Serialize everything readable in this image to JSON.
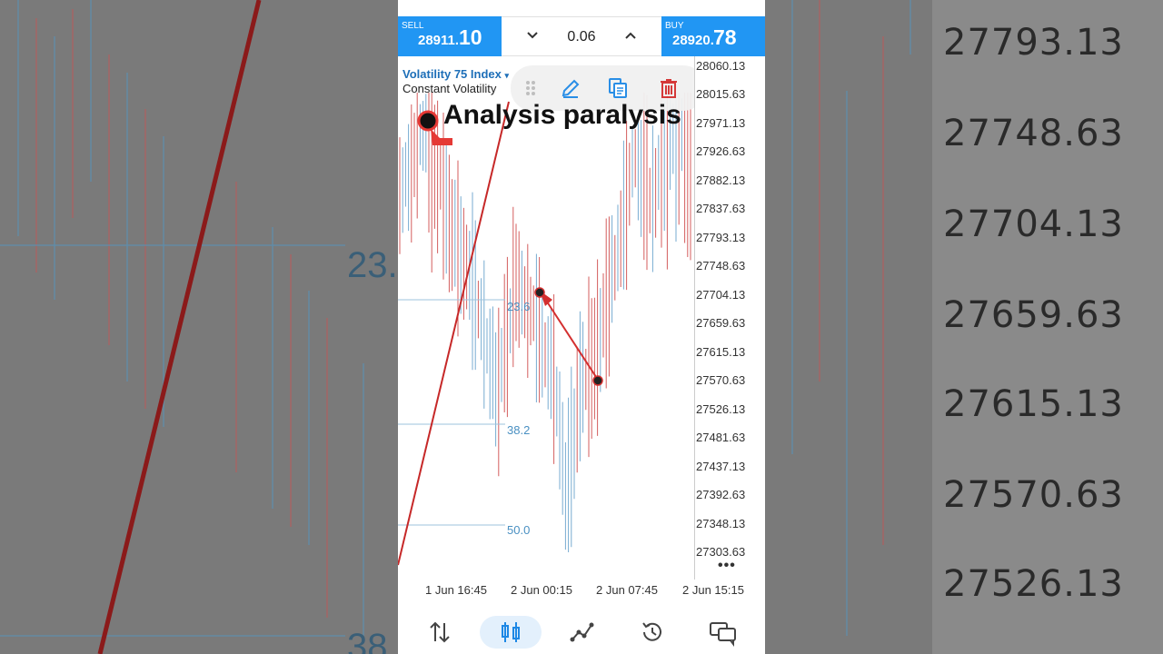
{
  "trade": {
    "sell_label": "SELL",
    "sell_price_main": "28911.",
    "sell_price_big": "10",
    "buy_label": "BUY",
    "buy_price_main": "28920.",
    "buy_price_big": "78",
    "volume": "0.06"
  },
  "chart": {
    "symbol": "Volatility 75 Index",
    "symbol_caret": "▾",
    "subtitle": "Constant Volatility",
    "overlay_text": "Analysis paralysis",
    "fib_levels": [
      "23.6",
      "38.2",
      "50.0"
    ],
    "price_labels": [
      "28060.13",
      "28015.63",
      "27971.13",
      "27926.63",
      "27882.13",
      "27837.63",
      "27793.13",
      "27748.63",
      "27704.13",
      "27659.63",
      "27615.13",
      "27570.63",
      "27526.13",
      "27481.63",
      "27437.13",
      "27392.63",
      "27348.13",
      "27303.63"
    ],
    "time_labels": [
      "1 Jun 16:45",
      "2 Jun 00:15",
      "2 Jun 07:45",
      "2 Jun 15:15"
    ],
    "more_label": "•••"
  },
  "toolbar": {
    "icons": [
      "drag-handle-icon",
      "edit-pencil-icon",
      "copy-icon",
      "trash-icon"
    ]
  },
  "bottom_nav": {
    "icons": [
      "trade-arrows-icon",
      "candles-icon",
      "indicators-icon",
      "history-icon",
      "messages-icon"
    ],
    "active": "candles-icon"
  },
  "background": {
    "right_prices": [
      "27793.13",
      "27748.63",
      "27704.13",
      "27659.63",
      "27615.13",
      "27570.63",
      "27526.13"
    ],
    "left_fib": [
      "23.",
      "38"
    ]
  },
  "colors": {
    "accent": "#2196f3",
    "bear": "#c62828",
    "bull": "#4a90c2",
    "trash": "#d32f2f"
  }
}
